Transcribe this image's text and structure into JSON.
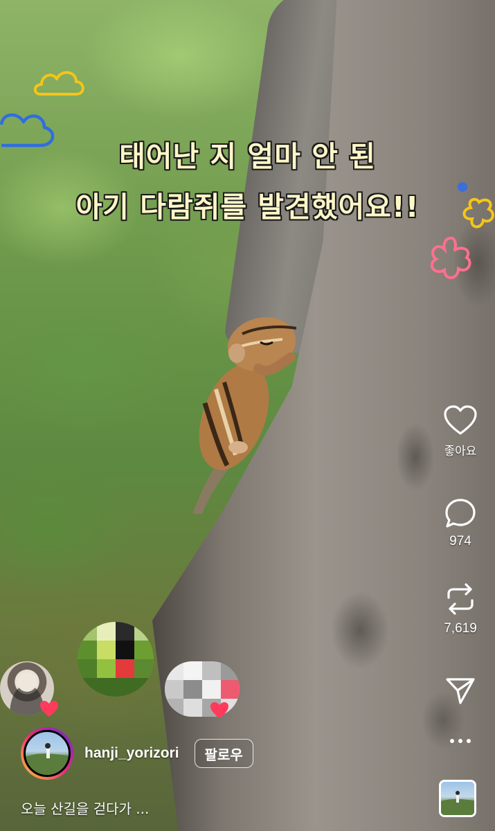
{
  "overlay": {
    "caption_line1": "태어난 지 얼마 안 된",
    "caption_line2": "아기 다람쥐를 발견했어요!!"
  },
  "actions": {
    "like": {
      "icon": "heart-outline-icon",
      "label": "좋아요"
    },
    "comment": {
      "icon": "comment-bubble-icon",
      "count": "974"
    },
    "repost": {
      "icon": "repost-icon",
      "count": "7,619"
    },
    "share": {
      "icon": "paper-plane-icon"
    },
    "more": {
      "icon": "more-dots-icon"
    }
  },
  "author": {
    "username": "hanji_yorizori",
    "follow_label": "팔로우"
  },
  "post": {
    "caption_preview": "오늘 산길을 걷다가 ..."
  },
  "colors": {
    "caption_fill": "#fdf6c8",
    "caption_outline": "#1a1a1a",
    "reaction_heart": "#ff3b5c",
    "story_ring_start": "#f9ce34",
    "story_ring_end": "#6228d7"
  }
}
